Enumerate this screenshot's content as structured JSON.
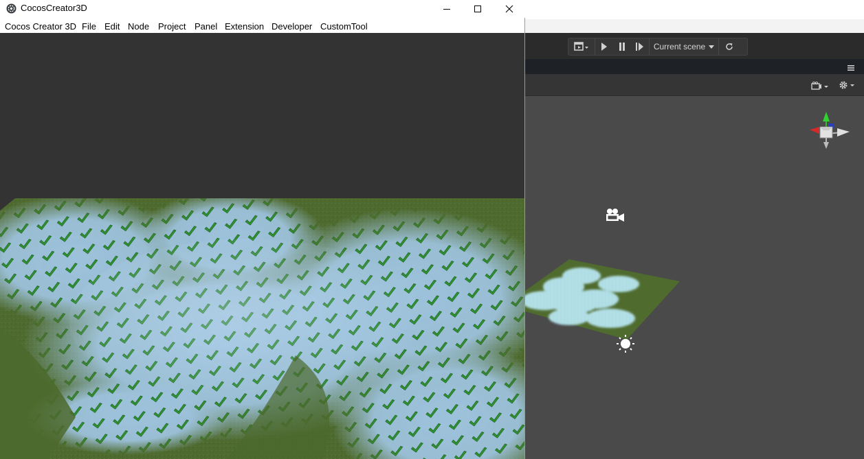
{
  "window": {
    "title": "CocosCreator3D",
    "controls": {
      "minimize": "minimize",
      "maximize": "maximize",
      "close": "close"
    }
  },
  "menu": {
    "items": [
      "Cocos Creator 3D",
      "File",
      "Edit",
      "Node",
      "Project",
      "Panel",
      "Extension",
      "Developer",
      "CustomTool"
    ]
  },
  "editor": {
    "scene_selector": "Current scene",
    "icons": [
      "scene-preview-icon",
      "play-icon",
      "pause-icon",
      "step-icon",
      "refresh-icon",
      "panel-menu-icon",
      "camera-options-icon",
      "settings-gear-icon",
      "axis-gizmo-icon",
      "scene-camera-icon",
      "directional-light-icon"
    ]
  },
  "colors": {
    "ground": "#4d6b2f",
    "water": "#a8d1e8",
    "checkmark": "#2e9a30",
    "editor_bg": "#4a4a4a",
    "toolbar_bg": "#2b2b2b"
  }
}
